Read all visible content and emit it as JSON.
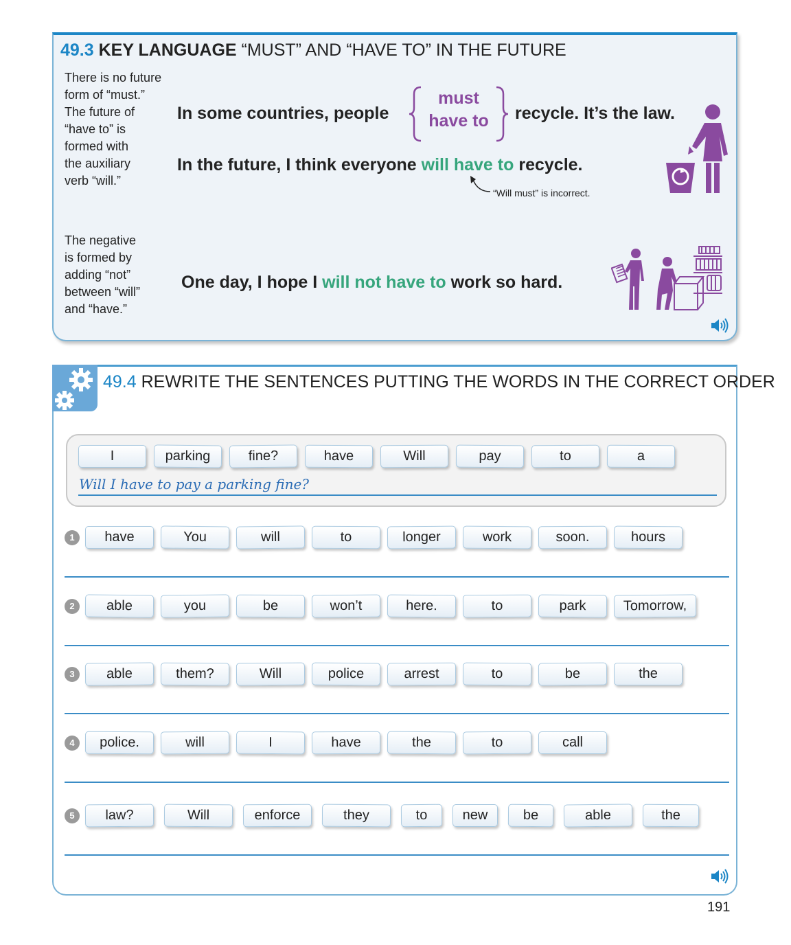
{
  "section_493": {
    "number": "49.3",
    "key": "KEY LANGUAGE",
    "title_rest": "“MUST” AND “HAVE TO” IN THE FUTURE",
    "note_1": [
      "There is no future",
      "form of “must.”",
      "The future of",
      "“have to” is",
      "formed with",
      "the auxiliary",
      "verb “will.”"
    ],
    "sentence_1": {
      "before": "In some countries, people",
      "option_1": "must",
      "option_2": "have to",
      "after": "recycle. It’s the law."
    },
    "sentence_2": {
      "before": "In the future, I think everyone",
      "highlight": "will have to",
      "after": "recycle."
    },
    "arrow_note": "“Will must” is incorrect.",
    "note_2": [
      "The negative",
      "is formed by",
      "adding “not”",
      "between “will”",
      "and “have.”"
    ],
    "sentence_3": {
      "before": "One day, I hope I",
      "highlight": "will not have to",
      "after": "work so hard."
    },
    "colors": {
      "accent": "#1c86c6",
      "purple": "#8a4a9f",
      "green": "#36a57c"
    }
  },
  "section_494": {
    "number": "49.4",
    "title": "REWRITE THE SENTENCES PUTTING THE WORDS IN THE CORRECT ORDER",
    "example_words": [
      "I",
      "parking",
      "fine?",
      "have",
      "Will",
      "pay",
      "to",
      "a"
    ],
    "example_answer": "Will I have to pay a parking fine?",
    "rows": [
      {
        "number": "1",
        "words": [
          "have",
          "You",
          "will",
          "to",
          "longer",
          "work",
          "soon.",
          "hours"
        ]
      },
      {
        "number": "2",
        "words": [
          "able",
          "you",
          "be",
          "won’t",
          "here.",
          "to",
          "park",
          "Tomorrow,"
        ]
      },
      {
        "number": "3",
        "words": [
          "able",
          "them?",
          "Will",
          "police",
          "arrest",
          "to",
          "be",
          "the"
        ]
      },
      {
        "number": "4",
        "words": [
          "police.",
          "will",
          "I",
          "have",
          "the",
          "to",
          "call"
        ]
      },
      {
        "number": "5",
        "words": [
          "law?",
          "Will",
          "enforce",
          "they",
          "to",
          "new",
          "be",
          "able",
          "the"
        ]
      }
    ]
  },
  "page_number": "191"
}
